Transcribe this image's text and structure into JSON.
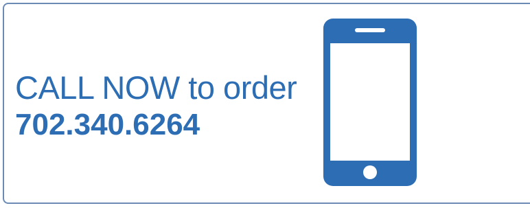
{
  "cta": {
    "line1": "CALL NOW to order",
    "phone_number": "702.340.6264"
  },
  "icon": {
    "name": "smartphone-icon",
    "color": "#2c6db3"
  },
  "colors": {
    "text": "#2c6db3",
    "border": "#6b8bb5",
    "background": "#ffffff"
  }
}
